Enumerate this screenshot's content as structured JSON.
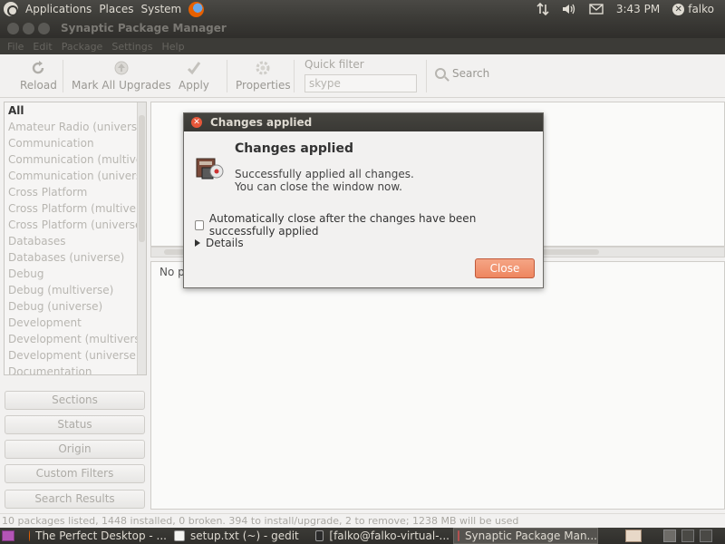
{
  "top_panel": {
    "menus": [
      "Applications",
      "Places",
      "System"
    ],
    "clock": "3:43 PM",
    "user": "falko"
  },
  "window": {
    "title": "Synaptic Package Manager",
    "menubar": [
      "File",
      "Edit",
      "Package",
      "Settings",
      "Help"
    ]
  },
  "toolbar": {
    "reload": "Reload",
    "mark_all_upgrades": "Mark All Upgrades",
    "apply": "Apply",
    "properties": "Properties",
    "quick_filter_label": "Quick filter",
    "quick_filter_value": "skype",
    "search": "Search"
  },
  "sections": [
    "All",
    "Amateur Radio (universe)",
    "Communication",
    "Communication (multiverse)",
    "Communication (universe)",
    "Cross Platform",
    "Cross Platform (multiverse)",
    "Cross Platform (universe)",
    "Databases",
    "Databases (universe)",
    "Debug",
    "Debug (multiverse)",
    "Debug (universe)",
    "Development",
    "Development (multiverse)",
    "Development (universe)",
    "Documentation"
  ],
  "side_buttons": {
    "sections": "Sections",
    "status": "Status",
    "origin": "Origin",
    "custom_filters": "Custom Filters",
    "search_results": "Search Results"
  },
  "description_area": {
    "text": "No p"
  },
  "statusbar": "10 packages listed, 1448 installed, 0 broken. 394 to install/upgrade, 2 to remove; 1238 MB will be used",
  "taskbar": {
    "tasks": [
      "The Perfect Desktop - ...",
      "setup.txt (~) - gedit",
      "[falko@falko-virtual-...",
      "Synaptic Package Man..."
    ]
  },
  "dialog": {
    "title": "Changes applied",
    "heading": "Changes applied",
    "message_line1": "Successfully applied all changes.",
    "message_line2": "You can close the window now.",
    "auto_close_label": "Automatically close after the changes have been successfully applied",
    "details_label": "Details",
    "close_button": "Close"
  }
}
